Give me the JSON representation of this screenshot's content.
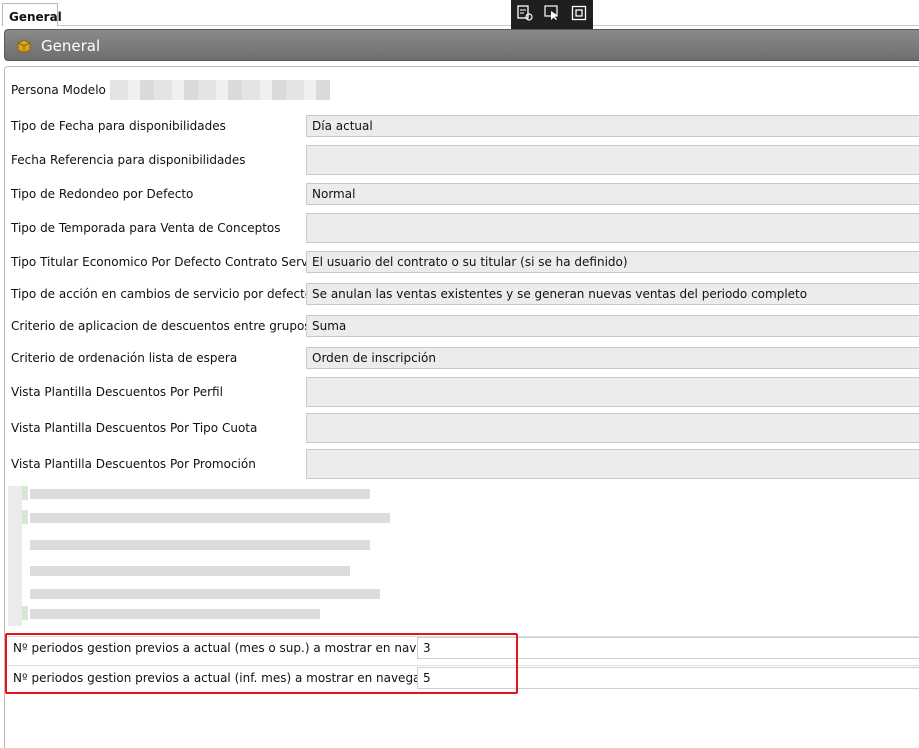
{
  "tab": {
    "label": "General"
  },
  "header": {
    "title": "General"
  },
  "persona_modelo": {
    "label": "Persona Modelo"
  },
  "fields": [
    {
      "label": "Tipo de Fecha para disponibilidades",
      "value": "Día actual"
    },
    {
      "label": "Fecha Referencia para disponibilidades",
      "value": ""
    },
    {
      "label": "Tipo de Redondeo por Defecto",
      "value": "Normal"
    },
    {
      "label": "Tipo de Temporada para Venta de Conceptos",
      "value": ""
    },
    {
      "label": "Tipo Titular Economico Por Defecto Contrato Servicio",
      "value": "El usuario del contrato o su titular (si se ha definido)"
    },
    {
      "label": "Tipo de acción en cambios de servicio por defecto",
      "value": "Se anulan las ventas existentes y se generan nuevas ventas del periodo completo"
    },
    {
      "label": "Criterio de aplicacion de descuentos entre grupos",
      "value": "Suma"
    },
    {
      "label": "Criterio de ordenación lista de espera",
      "value": "Orden de inscripción"
    },
    {
      "label": "Vista Plantilla Descuentos Por Perfil",
      "value": ""
    },
    {
      "label": "Vista Plantilla Descuentos Por Tipo Cuota",
      "value": ""
    },
    {
      "label": "Vista Plantilla Descuentos Por Promoción",
      "value": ""
    }
  ],
  "periodos": [
    {
      "label": "Nº periodos gestion previos a actual (mes o sup.) a mostrar en navegador",
      "value": "3"
    },
    {
      "label": "Nº periodos gestion previos a actual (inf. mes) a mostrar en navegador",
      "value": "5"
    }
  ],
  "icons": {
    "header": "box-icon",
    "toolbar": [
      "add-element-icon",
      "select-pointer-icon",
      "frame-icon"
    ]
  },
  "colors": {
    "highlight": "#e5141c",
    "header": "#7a7a7a"
  }
}
